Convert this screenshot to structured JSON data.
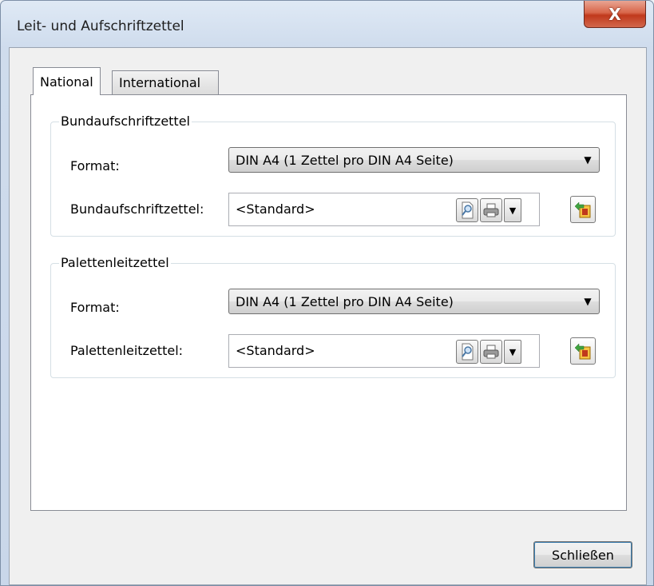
{
  "window": {
    "title": "Leit- und Aufschriftzettel",
    "close_glyph": "X"
  },
  "tabs": [
    {
      "label": "National",
      "selected": true
    },
    {
      "label": "International",
      "selected": false
    }
  ],
  "groups": {
    "bund": {
      "title": "Bundaufschriftzettel",
      "format_label": "Format:",
      "format_value": "DIN A4 (1 Zettel pro DIN A4 Seite)",
      "field_label": "Bundaufschriftzettel:",
      "field_value": "<Standard>"
    },
    "palette": {
      "title": "Palettenleitzettel",
      "format_label": "Format:",
      "format_value": "DIN A4 (1 Zettel pro DIN A4 Seite)",
      "field_label": "Palettenleitzettel:",
      "field_value": "<Standard>"
    }
  },
  "icons": {
    "preview": "preview-icon",
    "print": "printer-icon",
    "dropdown": "chevron-down-icon",
    "add": "add-label-icon"
  },
  "footer": {
    "close_label": "Schließen"
  },
  "colors": {
    "accent": "#3c7fb1",
    "close_red": "#c0391c"
  }
}
